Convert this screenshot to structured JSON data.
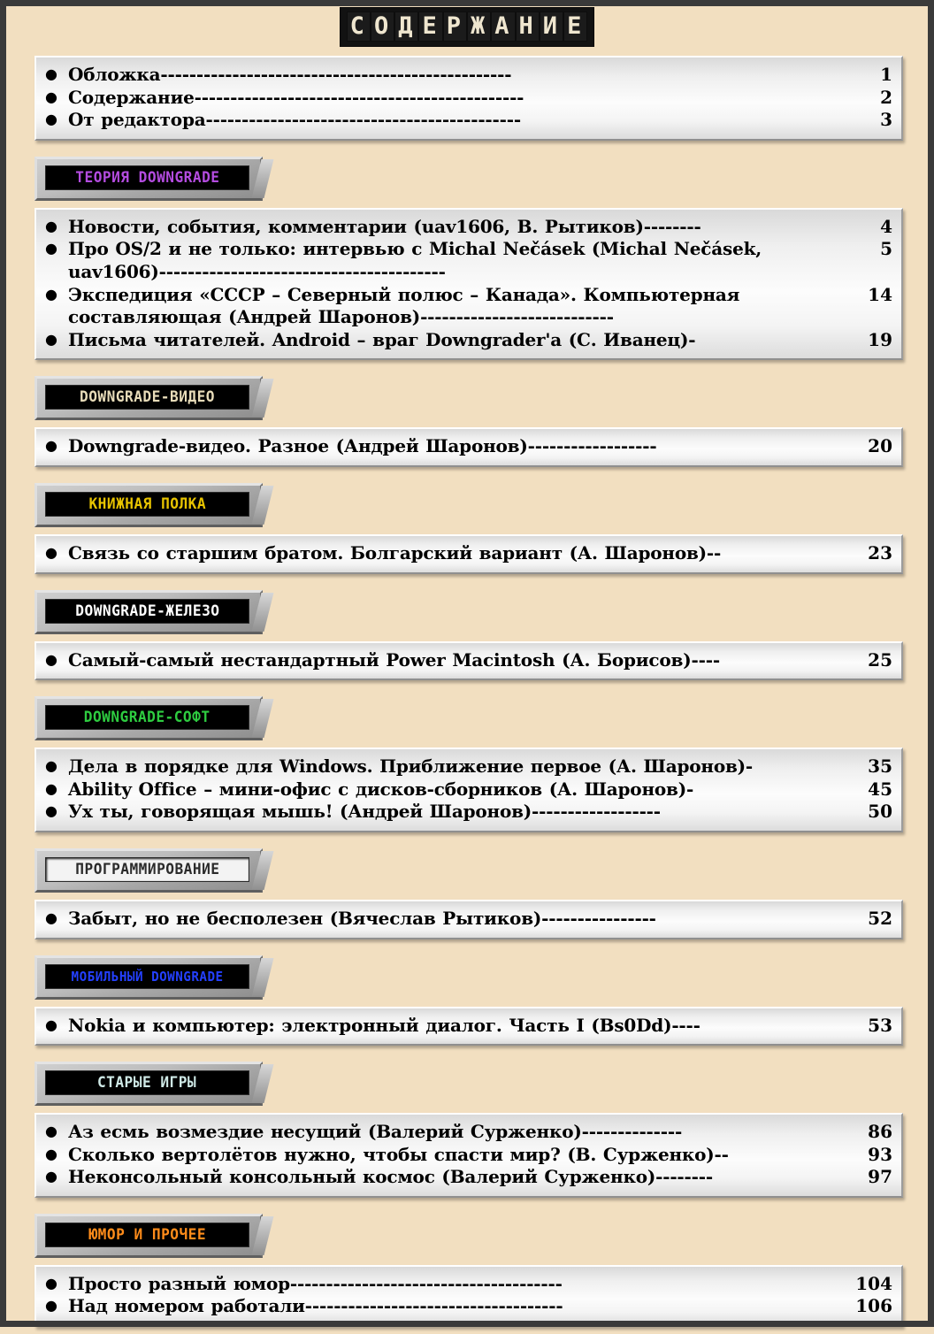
{
  "page": {
    "title": "СОДЕРЖАНИЕ",
    "background_color": "#f2dfc0",
    "frame_color": "#3a3a3a"
  },
  "intro": {
    "entries": [
      {
        "text": "Обложка",
        "dashes": "-------------------------------------------------",
        "page": "1"
      },
      {
        "text": "Содержание",
        "dashes": "----------------------------------------------",
        "page": "2"
      },
      {
        "text": "От редактора",
        "dashes": "--------------------------------------------",
        "page": "3"
      }
    ]
  },
  "sections": [
    {
      "header": "ТЕОРИЯ DOWNGRADE",
      "header_color": "#b44ce0",
      "header_inverted": false,
      "entries": [
        {
          "text": "Новости, события, комментарии (uav1606, В. Рытиков)",
          "dashes": "--------",
          "page": "4"
        },
        {
          "text": "Про OS/2 и не только: интервью с Michal Nečásek (Michal Nečásek, uav1606)",
          "dashes": "----------------------------------------",
          "page": "5"
        },
        {
          "text": "Экспедиция «СССР – Северный полюс – Канада». Компьютерная составляющая (Андрей Шаронов)",
          "dashes": "---------------------------",
          "page": "14"
        },
        {
          "text": "Письма читателей. Android – враг Downgrader'a (С. Иванец)",
          "dashes": "-",
          "page": "19"
        }
      ]
    },
    {
      "header": "DOWNGRADE-ВИДЕО",
      "header_color": "#e8dcb9",
      "header_inverted": false,
      "entries": [
        {
          "text": "Downgrade-видео. Разное (Андрей Шаронов)",
          "dashes": "------------------",
          "page": "20"
        }
      ]
    },
    {
      "header": "КНИЖНАЯ ПОЛКА",
      "header_color": "#e8c400",
      "header_inverted": false,
      "entries": [
        {
          "text": "Связь со старшим братом. Болгарский вариант (А. Шаронов)",
          "dashes": "--",
          "page": "23"
        }
      ]
    },
    {
      "header": "DOWNGRADE-ЖЕЛЕЗО",
      "header_color": "#ffffff",
      "header_inverted": false,
      "entries": [
        {
          "text": "Самый-самый нестандартный Power Macintosh (А. Борисов)",
          "dashes": "----",
          "page": "25"
        }
      ]
    },
    {
      "header": "DOWNGRADE-СОФТ",
      "header_color": "#2ecc40",
      "header_inverted": false,
      "entries": [
        {
          "text": "Дела в порядке для Windows. Приближение первое (А. Шаронов)",
          "dashes": "-",
          "page": "35"
        },
        {
          "text": "Ability Office – мини-офис с дисков-сборников (А. Шаронов)",
          "dashes": "-",
          "page": "45"
        },
        {
          "text": "Ух ты, говорящая мышь! (Андрей Шаронов)",
          "dashes": "------------------",
          "page": "50"
        }
      ]
    },
    {
      "header": "ПРОГРАММИРОВАНИЕ",
      "header_color": "#2b2b2b",
      "header_inverted": true,
      "entries": [
        {
          "text": "Забыт, но не бесполезен (Вячеслав Рытиков)",
          "dashes": "----------------",
          "page": "52"
        }
      ]
    },
    {
      "header": "МОБИЛЬНЫЙ DOWNGRADE",
      "header_color": "#2440ff",
      "header_inverted": false,
      "entries": [
        {
          "text": "Nokia и компьютер: электронный диалог. Часть I (Bs0Dd)",
          "dashes": "----",
          "page": "53"
        }
      ]
    },
    {
      "header": "СТАРЫЕ ИГРЫ",
      "header_color": "#cfe9e6",
      "header_inverted": false,
      "entries": [
        {
          "text": "Аз есмь возмездие несущий (Валерий Сурженко)",
          "dashes": "--------------",
          "page": "86"
        },
        {
          "text": "Сколько вертолётов нужно, чтобы спасти мир? (В. Сурженко)",
          "dashes": "--",
          "page": "93"
        },
        {
          "text": "Неконсольный консольный космос (Валерий Сурженко)",
          "dashes": "--------",
          "page": "97"
        }
      ]
    },
    {
      "header": "ЮМОР И ПРОЧЕЕ",
      "header_color": "#ff8c1a",
      "header_inverted": false,
      "entries": [
        {
          "text": "Просто разный юмор",
          "dashes": "--------------------------------------",
          "page": "104"
        },
        {
          "text": "Над номером работали",
          "dashes": "------------------------------------",
          "page": "106"
        }
      ]
    }
  ],
  "icons": {
    "bullet": "●"
  }
}
